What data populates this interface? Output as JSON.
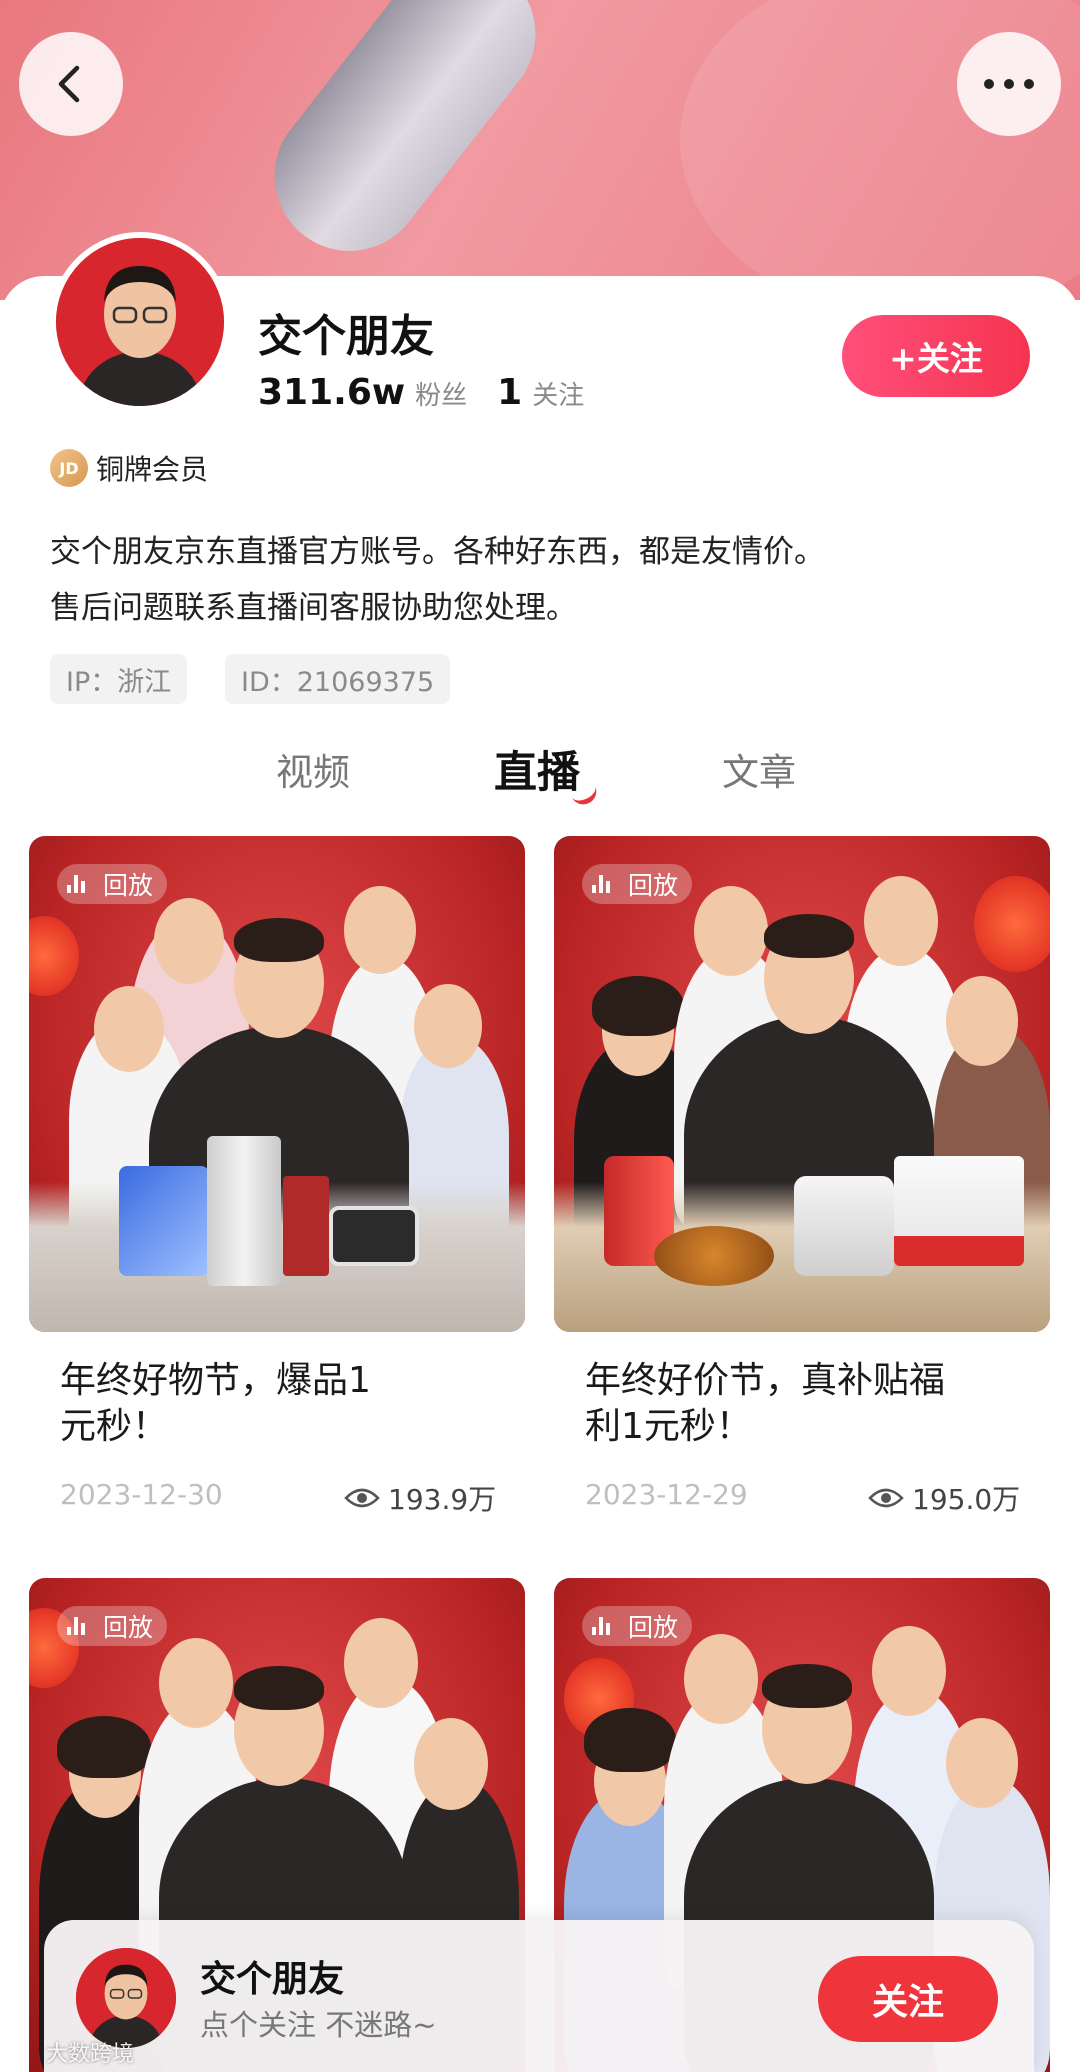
{
  "header": {
    "back_icon": "chevron-left-icon",
    "more_icon": "more-horizontal-icon"
  },
  "profile": {
    "name": "交个朋友",
    "fans_count": "311.6w",
    "fans_label": "粉丝",
    "following_count": "1",
    "following_label": "关注",
    "follow_button": "+关注",
    "member_badge": "JD",
    "member_label": "铜牌会员",
    "bio_line1": "交个朋友京东直播官方账号。各种好东西，都是友情价。",
    "bio_line2": "售后问题联系直播间客服协助您处理。",
    "ip_tag": "IP：浙江",
    "id_tag": "ID：21069375"
  },
  "tabs": [
    {
      "label": "视频",
      "active": false
    },
    {
      "label": "直播",
      "active": true
    },
    {
      "label": "文章",
      "active": false
    }
  ],
  "replays": [
    {
      "badge": "回放",
      "title_line1": "年终好物节，爆品1",
      "title_line2": "元秒！",
      "date": "2023-12-30",
      "views": "193.9万"
    },
    {
      "badge": "回放",
      "title_line1": "年终好价节，真补贴福",
      "title_line2": "利1元秒！",
      "date": "2023-12-29",
      "views": "195.0万"
    },
    {
      "badge": "回放"
    },
    {
      "badge": "回放"
    }
  ],
  "floating_bar": {
    "name": "交个朋友",
    "subtitle": "点个关注 不迷路~",
    "follow_button": "关注"
  },
  "watermark": "大数跨境",
  "colors": {
    "accent_red": "#f0343b",
    "follow_gradient_start": "#ff4f7b",
    "follow_gradient_end": "#f5344f",
    "banner_pink": "#ec7b85"
  }
}
